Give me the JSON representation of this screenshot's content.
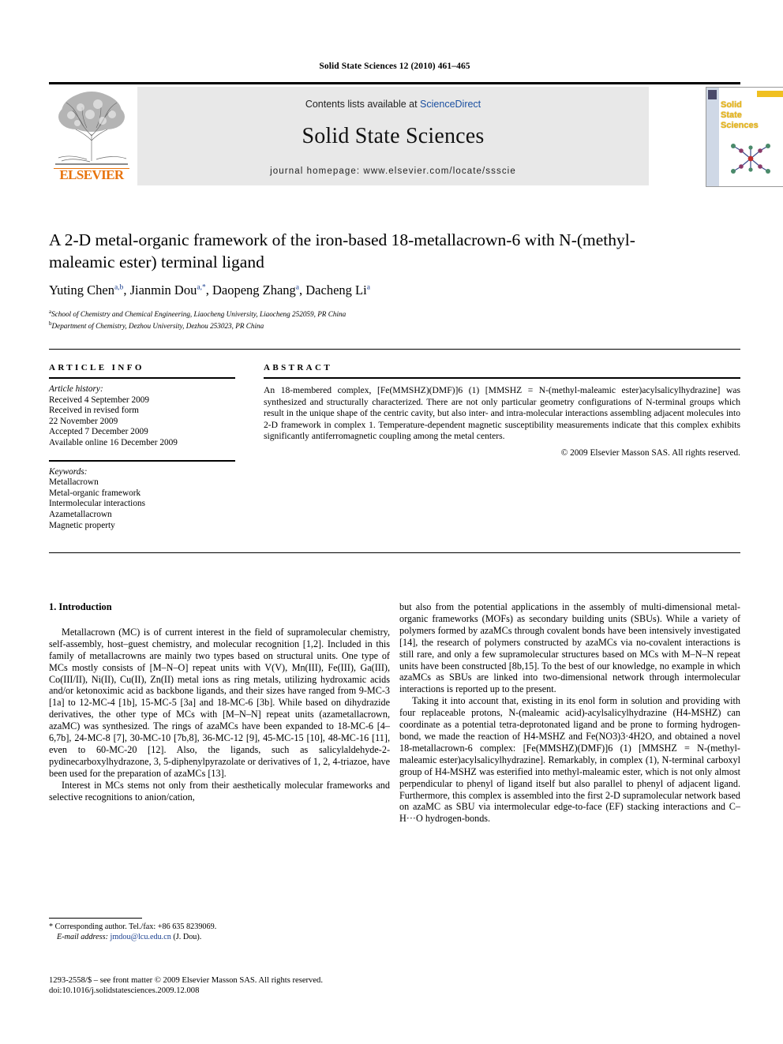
{
  "running_head": "Solid State Sciences 12 (2010) 461–465",
  "masthead": {
    "contents_prefix": "Contents lists available at ",
    "sciencedirect": "ScienceDirect",
    "journal_title": "Solid State Sciences",
    "homepage": "journal homepage: www.elsevier.com/locate/ssscie",
    "publisher_wordmark": "ELSEVIER",
    "cover_title_line1": "Solid",
    "cover_title_line2": "State",
    "cover_title_line3": "Sciences",
    "link_color": "#1a4fa0",
    "elsevier_orange": "#E8730C",
    "cover_title_color": "#e8b820"
  },
  "article": {
    "title": "A 2-D metal-organic framework of the iron-based 18-metallacrown-6 with N-(methyl-maleamic ester) terminal ligand",
    "authors": [
      {
        "name": "Yuting Chen",
        "marks": "a,b"
      },
      {
        "name": "Jianmin Dou",
        "marks": "a,*"
      },
      {
        "name": "Daopeng Zhang",
        "marks": "a"
      },
      {
        "name": "Dacheng Li",
        "marks": "a"
      }
    ],
    "affiliations": [
      {
        "mark": "a",
        "text": "School of Chemistry and Chemical Engineering, Liaocheng University, Liaocheng 252059, PR China"
      },
      {
        "mark": "b",
        "text": "Department of Chemistry, Dezhou University, Dezhou 253023, PR China"
      }
    ]
  },
  "article_info": {
    "heading": "ARTICLE INFO",
    "history_label": "Article history:",
    "history": [
      "Received 4 September 2009",
      "Received in revised form",
      "22 November 2009",
      "Accepted 7 December 2009",
      "Available online 16 December 2009"
    ],
    "keywords_label": "Keywords:",
    "keywords": [
      "Metallacrown",
      "Metal-organic framework",
      "Intermolecular interactions",
      "Azametallacrown",
      "Magnetic property"
    ]
  },
  "abstract": {
    "heading": "ABSTRACT",
    "text": "An 18-membered complex, [Fe(MMSHZ)(DMF)]6 (1) [MMSHZ = N-(methyl-maleamic ester)acylsalicylhydrazine] was synthesized and structurally characterized. There are not only particular geometry configurations of N-terminal groups which result in the unique shape of the centric cavity, but also inter- and intra-molecular interactions assembling adjacent molecules into 2-D framework in complex 1. Temperature-dependent magnetic susceptibility measurements indicate that this complex exhibits significantly antiferromagnetic coupling among the metal centers.",
    "copyright": "© 2009 Elsevier Masson SAS. All rights reserved."
  },
  "body": {
    "section_heading": "1. Introduction",
    "left_paragraphs": [
      "Metallacrown (MC) is of current interest in the field of supramolecular chemistry, self-assembly, host–guest chemistry, and molecular recognition [1,2]. Included in this family of metallacrowns are mainly two types based on structural units. One type of MCs mostly consists of [M–N–O] repeat units with V(V), Mn(III), Fe(III), Ga(III), Co(III/II), Ni(II), Cu(II), Zn(II) metal ions as ring metals, utilizing hydroxamic acids and/or ketonoximic acid as backbone ligands, and their sizes have ranged from 9-MC-3 [1a] to 12-MC-4 [1b], 15-MC-5 [3a] and 18-MC-6 [3b]. While based on dihydrazide derivatives, the other type of MCs with [M–N–N] repeat units (azametallacrown, azaMC) was synthesized. The rings of azaMCs have been expanded to 18-MC-6 [4–6,7b], 24-MC-8 [7], 30-MC-10 [7b,8], 36-MC-12 [9], 45-MC-15 [10], 48-MC-16 [11], even to 60-MC-20 [12]. Also, the ligands, such as salicylaldehyde-2-pydinecarboxylhydrazone, 3, 5-diphenylpyrazolate or derivatives of 1, 2, 4-triazoe, have been used for the preparation of azaMCs [13].",
      "Interest in MCs stems not only from their aesthetically molecular frameworks and selective recognitions to anion/cation,"
    ],
    "right_paragraphs": [
      "but also from the potential applications in the assembly of multi-dimensional metal-organic frameworks (MOFs) as secondary building units (SBUs). While a variety of polymers formed by azaMCs through covalent bonds have been intensively investigated [14], the research of polymers constructed by azaMCs via no-covalent interactions is still rare, and only a few supramolecular structures based on MCs with M–N–N repeat units have been constructed [8b,15]. To the best of our knowledge, no example in which azaMCs as SBUs are linked into two-dimensional network through intermolecular interactions is reported up to the present.",
      "Taking it into account that, existing in its enol form in solution and providing with four replaceable protons, N-(maleamic acid)-acylsalicylhydrazine (H4-MSHZ) can coordinate as a potential tetra-deprotonated ligand and be prone to forming hydrogen-bond, we made the reaction of H4-MSHZ and Fe(NO3)3·4H2O, and obtained a novel 18-metallacrown-6 complex: [Fe(MMSHZ)(DMF)]6 (1) [MMSHZ = N-(methyl-maleamic ester)acylsalicylhydrazine]. Remarkably, in complex (1), N-terminal carboxyl group of H4-MSHZ was esterified into methyl-maleamic ester, which is not only almost perpendicular to phenyl of ligand itself but also parallel to phenyl of adjacent ligand. Furthermore, this complex is assembled into the first 2-D supramolecular network based on azaMC as SBU via intermolecular edge-to-face (EF) stacking interactions and C–H···O hydrogen-bonds."
    ]
  },
  "footnote": {
    "corresponding": "* Corresponding author. Tel./fax: +86 635 8239069.",
    "email_label": "E-mail address:",
    "email": "jmdou@lcu.edu.cn",
    "email_suffix": "(J. Dou)."
  },
  "footer": {
    "issn_line": "1293-2558/$ – see front matter © 2009 Elsevier Masson SAS. All rights reserved.",
    "doi_line": "doi:10.1016/j.solidstatesciences.2009.12.008"
  }
}
